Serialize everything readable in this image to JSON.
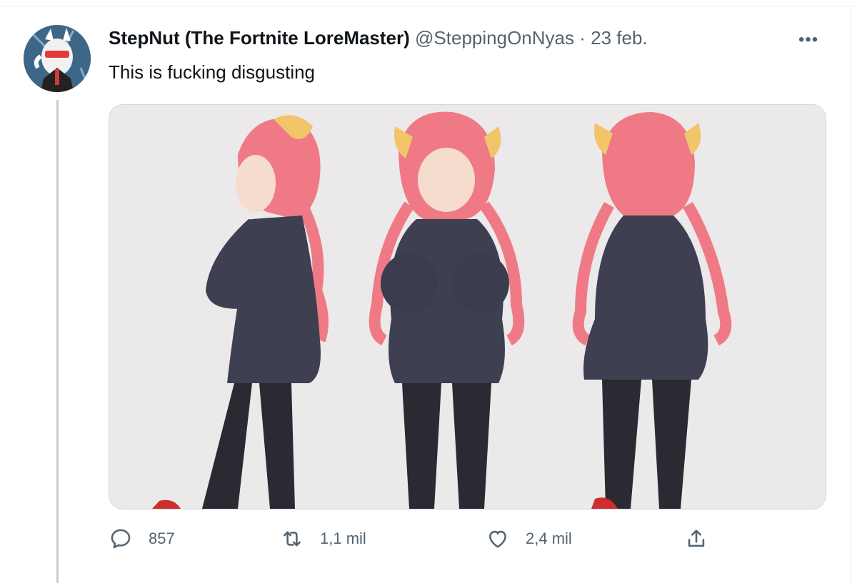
{
  "tweet": {
    "author_name": "StepNut (The Fortnite LoreMaster)",
    "handle": "@SteppingOnNyas",
    "separator": "·",
    "date": "23 feb.",
    "more_label": "•••",
    "text": "This is fucking disgusting"
  },
  "actions": {
    "reply_count": "857",
    "retweet_count": "1,1 mil",
    "like_count": "2,4 mil"
  },
  "icons": {
    "avatar": "avatar-image",
    "reply": "reply-icon",
    "retweet": "retweet-icon",
    "like": "heart-icon",
    "share": "share-icon",
    "more": "more-icon"
  },
  "colors": {
    "secondary_text": "#536471",
    "border": "#cfd9de",
    "thread_line": "#c4cfd6"
  }
}
